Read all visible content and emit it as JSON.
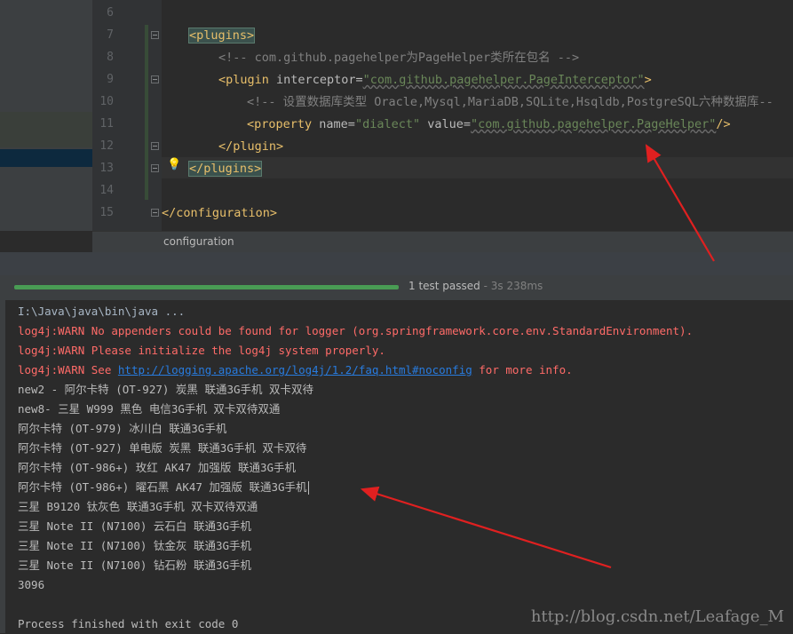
{
  "editor": {
    "line_numbers": [
      "6",
      "7",
      "8",
      "9",
      "10",
      "11",
      "12",
      "13",
      "14",
      "15"
    ],
    "lines": {
      "l7": {
        "open": "<",
        "tag": "plugins",
        "close": ">"
      },
      "l8": {
        "comment": "<!-- com.github.pagehelper为PageHelper类所在包名 -->"
      },
      "l9": {
        "open": "<",
        "tag": "plugin",
        "attr": " interceptor=",
        "val": "\"com.github.pagehelper.PageInterceptor\"",
        "close": ">"
      },
      "l10": {
        "comment": "<!-- 设置数据库类型 Oracle,Mysql,MariaDB,SQLite,Hsqldb,PostgreSQL六种数据库--"
      },
      "l11": {
        "open": "<",
        "tag": "property",
        "attr1": " name=",
        "val1": "\"dialect\"",
        "attr2": " value=",
        "val2": "\"com.github.pagehelper.PageHelper\"",
        "close": "/>"
      },
      "l12": {
        "text": "</plugin>"
      },
      "l13": {
        "text": "</plugins>"
      },
      "l15": {
        "text": "</configuration>"
      }
    }
  },
  "breadcrumb": {
    "label": "configuration"
  },
  "test_bar": {
    "status": "1 test passed",
    "time": " - 3s 238ms"
  },
  "console": {
    "lines": [
      {
        "type": "cmd",
        "text": "I:\\Java\\java\\bin\\java ..."
      },
      {
        "type": "warn",
        "text": "log4j:WARN No appenders could be found for logger (org.springframework.core.env.StandardEnvironment)."
      },
      {
        "type": "warn",
        "text": "log4j:WARN Please initialize the log4j system properly."
      },
      {
        "type": "warnlink",
        "pre": "log4j:WARN See ",
        "link": "http://logging.apache.org/log4j/1.2/faq.html#noconfig",
        "post": " for more info."
      },
      {
        "type": "out",
        "text": "new2 - 阿尔卡特 (OT-927) 炭黑 联通3G手机 双卡双待"
      },
      {
        "type": "out",
        "text": "new8- 三星 W999 黑色 电信3G手机 双卡双待双通"
      },
      {
        "type": "out",
        "text": "阿尔卡特 (OT-979) 冰川白 联通3G手机"
      },
      {
        "type": "out",
        "text": "阿尔卡特 (OT-927) 单电版 炭黑 联通3G手机 双卡双待"
      },
      {
        "type": "out",
        "text": "阿尔卡特 (OT-986+) 玫红 AK47 加强版 联通3G手机"
      },
      {
        "type": "out",
        "text": "阿尔卡特 (OT-986+) 曜石黑 AK47 加强版 联通3G手机"
      },
      {
        "type": "out",
        "text": "三星 B9120 钛灰色 联通3G手机 双卡双待双通"
      },
      {
        "type": "out",
        "text": "三星 Note II (N7100) 云石白 联通3G手机"
      },
      {
        "type": "out",
        "text": "三星 Note II (N7100) 钛金灰 联通3G手机"
      },
      {
        "type": "out",
        "text": "三星 Note II (N7100) 钻石粉 联通3G手机"
      },
      {
        "type": "out",
        "text": "3096"
      },
      {
        "type": "blank",
        "text": ""
      },
      {
        "type": "out",
        "text": "Process finished with exit code 0"
      }
    ]
  },
  "watermark": "http://blog.csdn.net/Leafage_M",
  "colors": {
    "arrow": "#e02020",
    "progress": "#499c54",
    "warn": "#ff6b68",
    "link": "#287bde"
  }
}
